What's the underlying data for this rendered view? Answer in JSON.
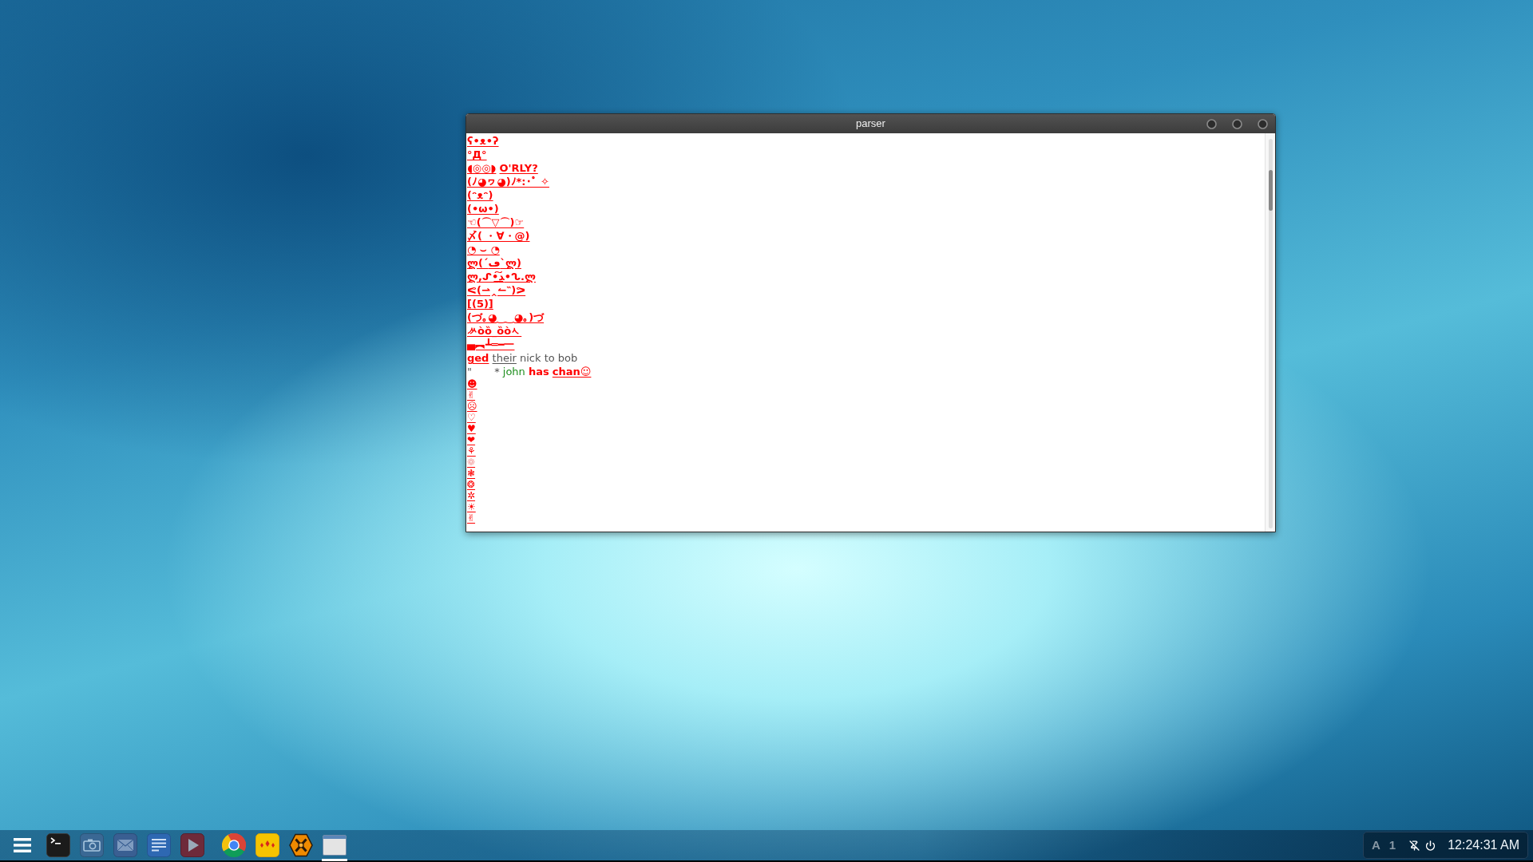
{
  "window": {
    "title": "parser",
    "log": [
      {
        "kind": "text",
        "segments": [
          {
            "kind": "emote",
            "text": "ʕ•ᴥ•ʔ"
          }
        ]
      },
      {
        "kind": "text",
        "segments": [
          {
            "kind": "emote",
            "text": "°Д°"
          }
        ]
      },
      {
        "kind": "text",
        "segments": [
          {
            "kind": "emote",
            "text": "◖◎◎◗"
          },
          {
            "kind": "emote",
            "text": "O'RLY?"
          }
        ]
      },
      {
        "kind": "text",
        "segments": [
          {
            "kind": "emote",
            "text": "(ﾉ◕ヮ◕)ﾉ*:･ﾟ ✧"
          }
        ]
      },
      {
        "kind": "text",
        "segments": [
          {
            "kind": "emote",
            "text": "(ᵔᴥᵔ)"
          }
        ]
      },
      {
        "kind": "text",
        "segments": [
          {
            "kind": "emote",
            "text": "(•ω•)"
          }
        ]
      },
      {
        "kind": "text",
        "segments": [
          {
            "kind": "emote",
            "text": "☜(⌒▽⌒)☞"
          }
        ]
      },
      {
        "kind": "text",
        "segments": [
          {
            "kind": "emote",
            "text": "〆( ・∀・@)"
          }
        ]
      },
      {
        "kind": "text",
        "segments": [
          {
            "kind": "emote",
            "text": "◔ ⌣ ◔"
          }
        ]
      },
      {
        "kind": "text",
        "segments": [
          {
            "kind": "emote",
            "text": "ლ(´ڡ`ლ)"
          }
        ]
      },
      {
        "kind": "text",
        "segments": [
          {
            "kind": "emote",
            "text": "ლ,ᔑ•ﺪ͟͠•ᔐ.ლ"
          }
        ]
      },
      {
        "kind": "text",
        "segments": [
          {
            "kind": "emote",
            "text": "ᕙ(⇀‸↼‶)ᕗ"
          }
        ]
      },
      {
        "kind": "text",
        "segments": [
          {
            "kind": "emote",
            "text": "[(5)]"
          }
        ]
      },
      {
        "kind": "text",
        "segments": [
          {
            "kind": "emote",
            "text": "(づ｡◕‿‿◕｡)づ"
          }
        ]
      },
      {
        "kind": "text",
        "segments": [
          {
            "kind": "emote",
            "text": "ᄽòȍ_ȍòᄾ"
          }
        ]
      },
      {
        "kind": "text",
        "segments": [
          {
            "kind": "emote",
            "text": "▄︻┻═━一"
          }
        ]
      },
      {
        "kind": "text",
        "segments": [
          {
            "kind": "emote",
            "text": "ged"
          },
          {
            "kind": "underlined",
            "text": "their"
          },
          {
            "kind": "plain",
            "text": "nick to bob"
          }
        ]
      },
      {
        "kind": "text",
        "segments": [
          {
            "kind": "plain",
            "text": "\""
          },
          {
            "kind": "bullet",
            "text": "*"
          },
          {
            "kind": "nick",
            "text": "john"
          },
          {
            "kind": "bold",
            "text": "has"
          },
          {
            "kind": "emote",
            "text": "chan☺"
          }
        ]
      },
      {
        "kind": "symbol",
        "segments": [
          {
            "kind": "emote",
            "text": "☻"
          }
        ]
      },
      {
        "kind": "symbol",
        "segments": [
          {
            "kind": "emote",
            "text": "✌"
          }
        ]
      },
      {
        "kind": "symbol",
        "segments": [
          {
            "kind": "emote",
            "text": "☹"
          }
        ]
      },
      {
        "kind": "symbol",
        "segments": [
          {
            "kind": "emote",
            "text": "♡"
          }
        ]
      },
      {
        "kind": "symbol",
        "segments": [
          {
            "kind": "emote",
            "text": "♥"
          }
        ]
      },
      {
        "kind": "symbol",
        "segments": [
          {
            "kind": "emote",
            "text": "❤"
          }
        ]
      },
      {
        "kind": "symbol",
        "segments": [
          {
            "kind": "emote",
            "text": "⚘"
          }
        ]
      },
      {
        "kind": "symbol",
        "segments": [
          {
            "kind": "faded",
            "text": "❁"
          }
        ]
      },
      {
        "kind": "symbol",
        "segments": [
          {
            "kind": "emote",
            "text": "❃"
          }
        ]
      },
      {
        "kind": "symbol",
        "segments": [
          {
            "kind": "emote",
            "text": "❂"
          }
        ]
      },
      {
        "kind": "symbol",
        "segments": [
          {
            "kind": "emote",
            "text": "✲"
          }
        ]
      },
      {
        "kind": "symbol",
        "segments": [
          {
            "kind": "emote",
            "text": "☀"
          }
        ]
      },
      {
        "kind": "symbol",
        "segments": [
          {
            "kind": "emote",
            "text": "✌"
          }
        ]
      }
    ]
  },
  "taskbar": {
    "launchers": [
      {
        "selected": false
      },
      {
        "selected": false
      },
      {
        "selected": false
      },
      {
        "selected": false
      },
      {
        "selected": false
      }
    ],
    "tasks": [
      {
        "selected": false
      },
      {
        "selected": false
      },
      {
        "selected": false
      },
      {
        "selected": true
      }
    ],
    "tray": {
      "keyboard_layout": "A",
      "workspace": "1",
      "clock": "12:24:31 AM"
    }
  }
}
